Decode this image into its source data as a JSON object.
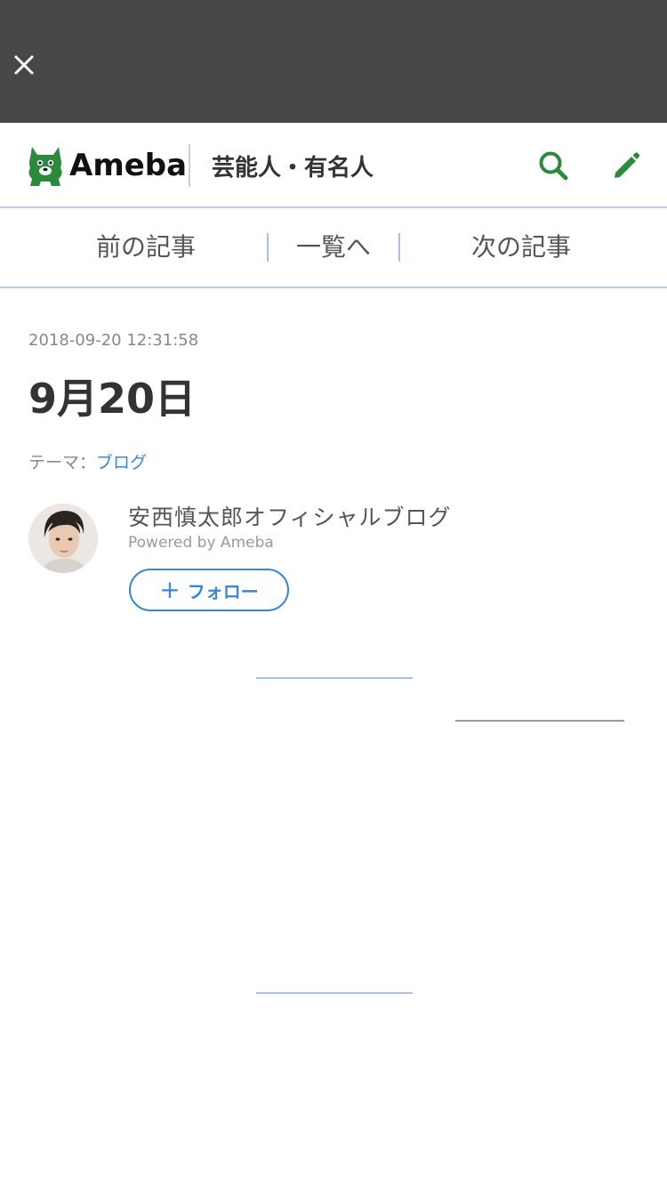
{
  "header": {
    "logo_text": "Ameba",
    "category": "芸能人・有名人",
    "colors": {
      "brand_green": "#2d8a3c",
      "topbar": "#474747",
      "link_blue": "#3b86d8"
    }
  },
  "pager": {
    "prev_label": "前の記事",
    "list_label": "一覧へ",
    "next_label": "次の記事"
  },
  "article": {
    "date": "2018-09-20 12:31:58",
    "title": "9月20日",
    "theme_label": "テーマ：",
    "theme_value": "ブログ"
  },
  "blog": {
    "name": "安西慎太郎オフィシャルブログ",
    "powered": "Powered by Ameba",
    "follow_label": "フォロー"
  },
  "icons": {
    "close": "close-icon",
    "search": "search-icon",
    "edit": "pencil-icon",
    "plus": "plus-icon"
  }
}
